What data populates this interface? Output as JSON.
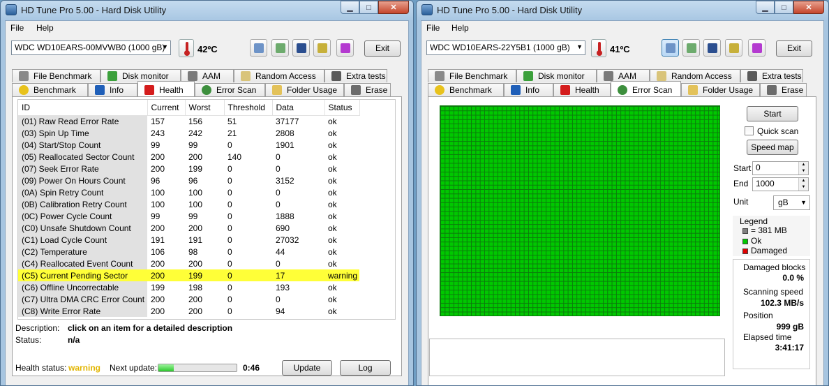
{
  "colors": {
    "health_warning": "#e2b500",
    "grid_ok": "#00c800",
    "legend_block": "#7f7f7f",
    "legend_ok": "#00c800",
    "legend_damaged": "#e00000",
    "row_highlight": "#ffff38"
  },
  "left": {
    "title": "HD Tune Pro 5.00 - Hard Disk Utility",
    "menu": [
      "File",
      "Help"
    ],
    "drive": "WDC WD10EARS-00MVWB0 (1000 gB)",
    "temperature": "42ºC",
    "exit_label": "Exit",
    "tabs_top": [
      {
        "label": "File Benchmark",
        "icon": "file-benchmark-icon"
      },
      {
        "label": "Disk monitor",
        "icon": "disk-monitor-icon"
      },
      {
        "label": "AAM",
        "icon": "speaker-icon"
      },
      {
        "label": "Random Access",
        "icon": "random-access-icon"
      },
      {
        "label": "Extra tests",
        "icon": "extra-tests-icon"
      }
    ],
    "tabs_bottom": [
      {
        "label": "Benchmark",
        "icon": "lightbulb-icon"
      },
      {
        "label": "Info",
        "icon": "info-icon"
      },
      {
        "label": "Health",
        "icon": "red-cross-icon"
      },
      {
        "label": "Error Scan",
        "icon": "magnifier-icon"
      },
      {
        "label": "Folder Usage",
        "icon": "folder-icon"
      },
      {
        "label": "Erase",
        "icon": "trash-icon"
      }
    ],
    "selected_tab": "Health",
    "table": {
      "headers": [
        "ID",
        "Current",
        "Worst",
        "Threshold",
        "Data",
        "Status"
      ],
      "rows": [
        [
          "(01) Raw Read Error Rate",
          "157",
          "156",
          "51",
          "37177",
          "ok"
        ],
        [
          "(03) Spin Up Time",
          "243",
          "242",
          "21",
          "2808",
          "ok"
        ],
        [
          "(04) Start/Stop Count",
          "99",
          "99",
          "0",
          "1901",
          "ok"
        ],
        [
          "(05) Reallocated Sector Count",
          "200",
          "200",
          "140",
          "0",
          "ok"
        ],
        [
          "(07) Seek Error Rate",
          "200",
          "199",
          "0",
          "0",
          "ok"
        ],
        [
          "(09) Power On Hours Count",
          "96",
          "96",
          "0",
          "3152",
          "ok"
        ],
        [
          "(0A) Spin Retry Count",
          "100",
          "100",
          "0",
          "0",
          "ok"
        ],
        [
          "(0B) Calibration Retry Count",
          "100",
          "100",
          "0",
          "0",
          "ok"
        ],
        [
          "(0C) Power Cycle Count",
          "99",
          "99",
          "0",
          "1888",
          "ok"
        ],
        [
          "(C0) Unsafe Shutdown Count",
          "200",
          "200",
          "0",
          "690",
          "ok"
        ],
        [
          "(C1) Load Cycle Count",
          "191",
          "191",
          "0",
          "27032",
          "ok"
        ],
        [
          "(C2) Temperature",
          "106",
          "98",
          "0",
          "44",
          "ok"
        ],
        [
          "(C4) Reallocated Event Count",
          "200",
          "200",
          "0",
          "0",
          "ok"
        ],
        [
          "(C5) Current Pending Sector",
          "200",
          "199",
          "0",
          "17",
          "warning"
        ],
        [
          "(C6) Offline Uncorrectable",
          "199",
          "198",
          "0",
          "193",
          "ok"
        ],
        [
          "(C7) Ultra DMA CRC Error Count",
          "200",
          "200",
          "0",
          "0",
          "ok"
        ],
        [
          "(C8) Write Error Rate",
          "200",
          "200",
          "0",
          "94",
          "ok"
        ]
      ],
      "highlighted_row": 13
    },
    "description_label": "Description:",
    "description_value": "click on an item for a detailed description",
    "status_label": "Status:",
    "status_value": "n/a",
    "health_status_label": "Health status:",
    "health_status_value": "warning",
    "next_update_label": "Next update:",
    "next_update_progress": 0.2,
    "next_update_time": "0:46",
    "update_button": "Update",
    "log_button": "Log"
  },
  "right": {
    "title": "HD Tune Pro 5.00 - Hard Disk Utility",
    "menu": [
      "File",
      "Help"
    ],
    "drive": "WDC WD10EARS-22Y5B1 (1000 gB)",
    "temperature": "41ºC",
    "exit_label": "Exit",
    "tabs_top": [
      {
        "label": "File Benchmark",
        "icon": "file-benchmark-icon"
      },
      {
        "label": "Disk monitor",
        "icon": "disk-monitor-icon"
      },
      {
        "label": "AAM",
        "icon": "speaker-icon"
      },
      {
        "label": "Random Access",
        "icon": "random-access-icon"
      },
      {
        "label": "Extra tests",
        "icon": "extra-tests-icon"
      }
    ],
    "tabs_bottom": [
      {
        "label": "Benchmark",
        "icon": "lightbulb-icon"
      },
      {
        "label": "Info",
        "icon": "info-icon"
      },
      {
        "label": "Health",
        "icon": "red-cross-icon"
      },
      {
        "label": "Error Scan",
        "icon": "magnifier-icon"
      },
      {
        "label": "Folder Usage",
        "icon": "folder-icon"
      },
      {
        "label": "Erase",
        "icon": "trash-icon"
      }
    ],
    "selected_tab": "Error Scan",
    "start_button": "Start",
    "quick_scan_label": "Quick scan",
    "quick_scan_checked": false,
    "speed_map_button": "Speed map",
    "start_label": "Start",
    "start_value": "0",
    "end_label": "End",
    "end_value": "1000",
    "unit_label": "Unit",
    "unit_value": "gB",
    "legend_title": "Legend",
    "legend_block": "= 381 MB",
    "legend_ok": "Ok",
    "legend_damaged": "Damaged",
    "damaged_blocks_label": "Damaged blocks",
    "damaged_blocks_value": "0.0 %",
    "scanning_speed_label": "Scanning speed",
    "scanning_speed_value": "102.3 MB/s",
    "position_label": "Position",
    "position_value": "999 gB",
    "elapsed_label": "Elapsed time",
    "elapsed_value": "3:41:17"
  }
}
